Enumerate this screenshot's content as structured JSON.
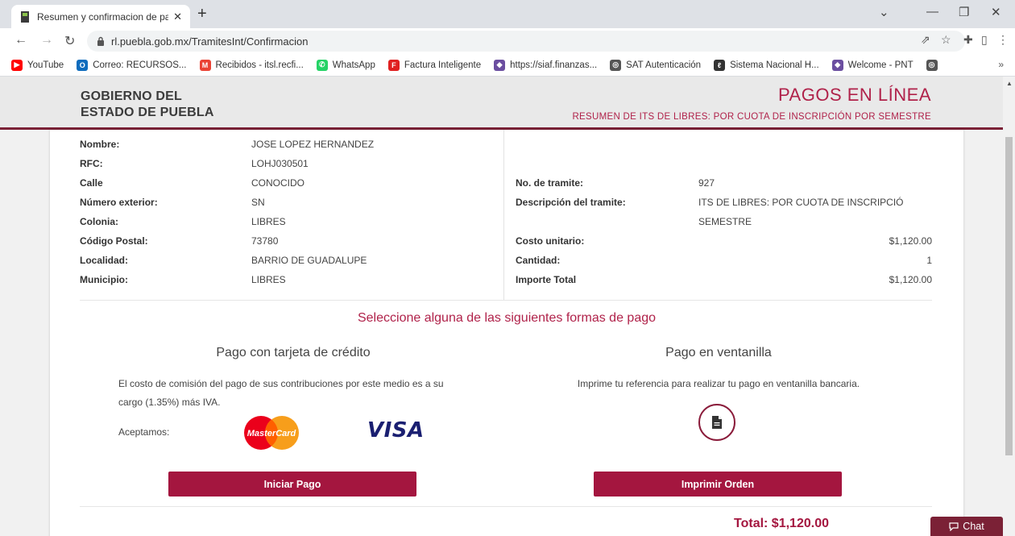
{
  "browser": {
    "tab_title": "Resumen y confirmacion de pago",
    "url": "rl.puebla.gob.mx/TramitesInt/Confirmacion",
    "bookmarks": [
      {
        "label": "YouTube",
        "icon": "youtube-icon",
        "color": "#ff0000"
      },
      {
        "label": "Correo: RECURSOS...",
        "icon": "outlook-icon",
        "color": "#0f6cbd"
      },
      {
        "label": "Recibidos - itsl.recfi...",
        "icon": "gmail-icon",
        "color": "#ea4335"
      },
      {
        "label": "WhatsApp",
        "icon": "whatsapp-icon",
        "color": "#25d366"
      },
      {
        "label": "Factura Inteligente",
        "icon": "factura-icon",
        "color": "#e02020"
      },
      {
        "label": "https://siaf.finanzas...",
        "icon": "siaf-icon",
        "color": "#6b4ea0"
      },
      {
        "label": "SAT Autenticación",
        "icon": "globe-icon",
        "color": "#555555"
      },
      {
        "label": "Sistema Nacional H...",
        "icon": "sistema-icon",
        "color": "#333333"
      },
      {
        "label": "Welcome - PNT",
        "icon": "pnt-icon",
        "color": "#6b4ea0"
      },
      {
        "label": "",
        "icon": "globe-icon",
        "color": "#555555"
      }
    ],
    "bookmarks_more": "»"
  },
  "header": {
    "gov_line1": "GOBIERNO DEL",
    "gov_line2": "ESTADO DE PUEBLA",
    "title": "PAGOS EN LÍNEA",
    "subtitle": "RESUMEN DE ITS DE LIBRES: POR CUOTA DE INSCRIPCIÓN POR SEMESTRE"
  },
  "contributor": [
    {
      "label": "Nombre:",
      "value": "JOSE LOPEZ HERNANDEZ"
    },
    {
      "label": "RFC:",
      "value": "LOHJ030501"
    },
    {
      "label": "Calle",
      "value": "CONOCIDO"
    },
    {
      "label": "Número exterior:",
      "value": "SN"
    },
    {
      "label": "Colonia:",
      "value": "LIBRES"
    },
    {
      "label": "Código Postal:",
      "value": "73780"
    },
    {
      "label": "Localidad:",
      "value": "BARRIO DE GUADALUPE"
    },
    {
      "label": "Municipio:",
      "value": "LIBRES"
    }
  ],
  "tramite": {
    "numero_label": "No. de tramite:",
    "numero": "927",
    "descripcion_label": "Descripción del tramite:",
    "descripcion_line1": "ITS DE LIBRES: POR CUOTA DE INSCRIPCIÓ",
    "descripcion_line2": "SEMESTRE",
    "costo_label": "Costo unitario:",
    "costo": "$1,120.00",
    "cantidad_label": "Cantidad:",
    "cantidad": "1",
    "importe_label": "Importe Total",
    "importe": "$1,120.00"
  },
  "payment": {
    "select_title": "Seleccione alguna de las siguientes formas de pago",
    "card_title": "Pago con tarjeta de crédito",
    "card_text_line1": "El costo de comisión del pago de sus contribuciones por este medio es a su",
    "card_text_line2": "cargo (1.35%) más IVA.",
    "accept_label": "Aceptamos:",
    "mastercard_text": "MasterCard",
    "visa_text": "VISA",
    "window_title": "Pago en ventanilla",
    "window_text": "Imprime tu referencia para realizar tu pago en ventanilla bancaria.",
    "start_button": "Iniciar Pago",
    "print_button": "Imprimir Orden",
    "total": "Total: $1,120.00"
  },
  "chat_label": "Chat",
  "colors": {
    "brand": "#a4163f",
    "brand_dark": "#7b2136",
    "accent_text": "#b0224a"
  }
}
